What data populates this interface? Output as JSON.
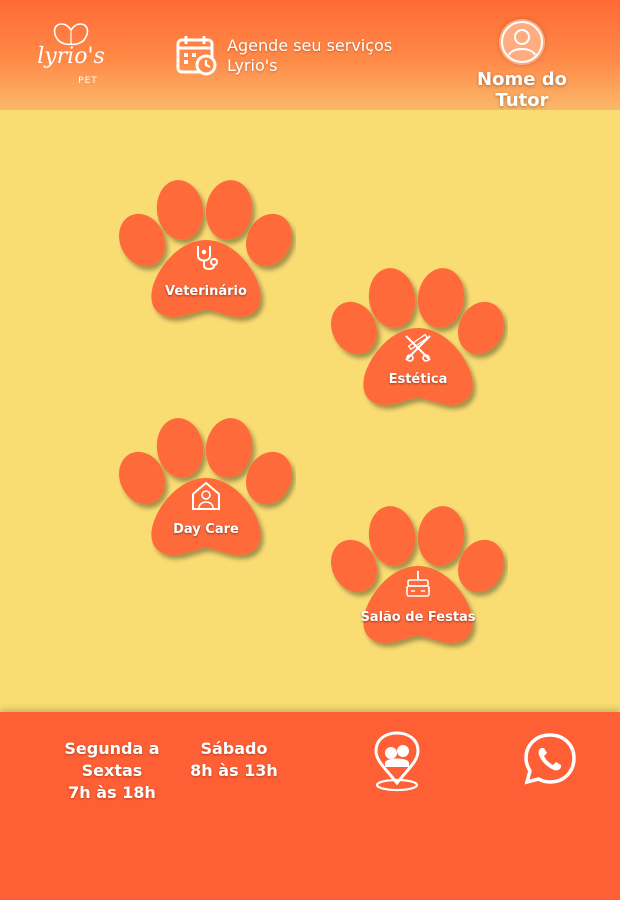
{
  "header": {
    "logo_text": "lyrio's",
    "logo_sub": "PET",
    "schedule_line1": "Agende seu serviços",
    "schedule_line2": "Lyrio's",
    "tutor_name": "Nome do Tutor"
  },
  "services": [
    {
      "label": "Veterinário",
      "icon": "stethoscope-icon"
    },
    {
      "label": "Estética",
      "icon": "scissors-comb-icon"
    },
    {
      "label": "Day Care",
      "icon": "pet-house-icon"
    },
    {
      "label": "Salão de Festas",
      "icon": "cake-icon"
    }
  ],
  "footer": {
    "weekdays_label": "Segunda a Sextas",
    "weekdays_hours": "7h às 18h",
    "saturday_label": "Sábado",
    "saturday_hours": "8h às 13h",
    "map_icon": "location-pin-icon",
    "whatsapp_icon": "whatsapp-icon"
  },
  "colors": {
    "background": "#fadd72",
    "accent": "#ff5f34",
    "paw": "#ff6a3a"
  }
}
